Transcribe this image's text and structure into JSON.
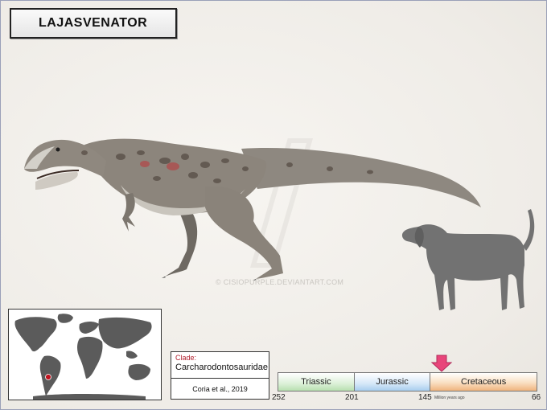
{
  "title": "LAJASVENATOR",
  "watermark": "© CISIOPURPLE.DEVIANTART.COM",
  "clade": {
    "label": "Clade:",
    "name": "Carcharodontosauridae",
    "reference": "Coria et al., 2019"
  },
  "timeline": {
    "periods": [
      "Triassic",
      "Jurassic",
      "Cretaceous"
    ],
    "ticks": [
      "252",
      "201",
      "145",
      "66"
    ],
    "unit": "Million years ago",
    "marker_position_mya": 136
  },
  "colors": {
    "marker": "#e8457a",
    "dinosaur_body": "#8c857c",
    "dog_silhouette": "#727272",
    "map_land": "#5b5b5b",
    "locality_dot": "#c0141f"
  },
  "icons": {
    "marker": "down-arrow-icon",
    "locality": "location-dot-icon"
  }
}
